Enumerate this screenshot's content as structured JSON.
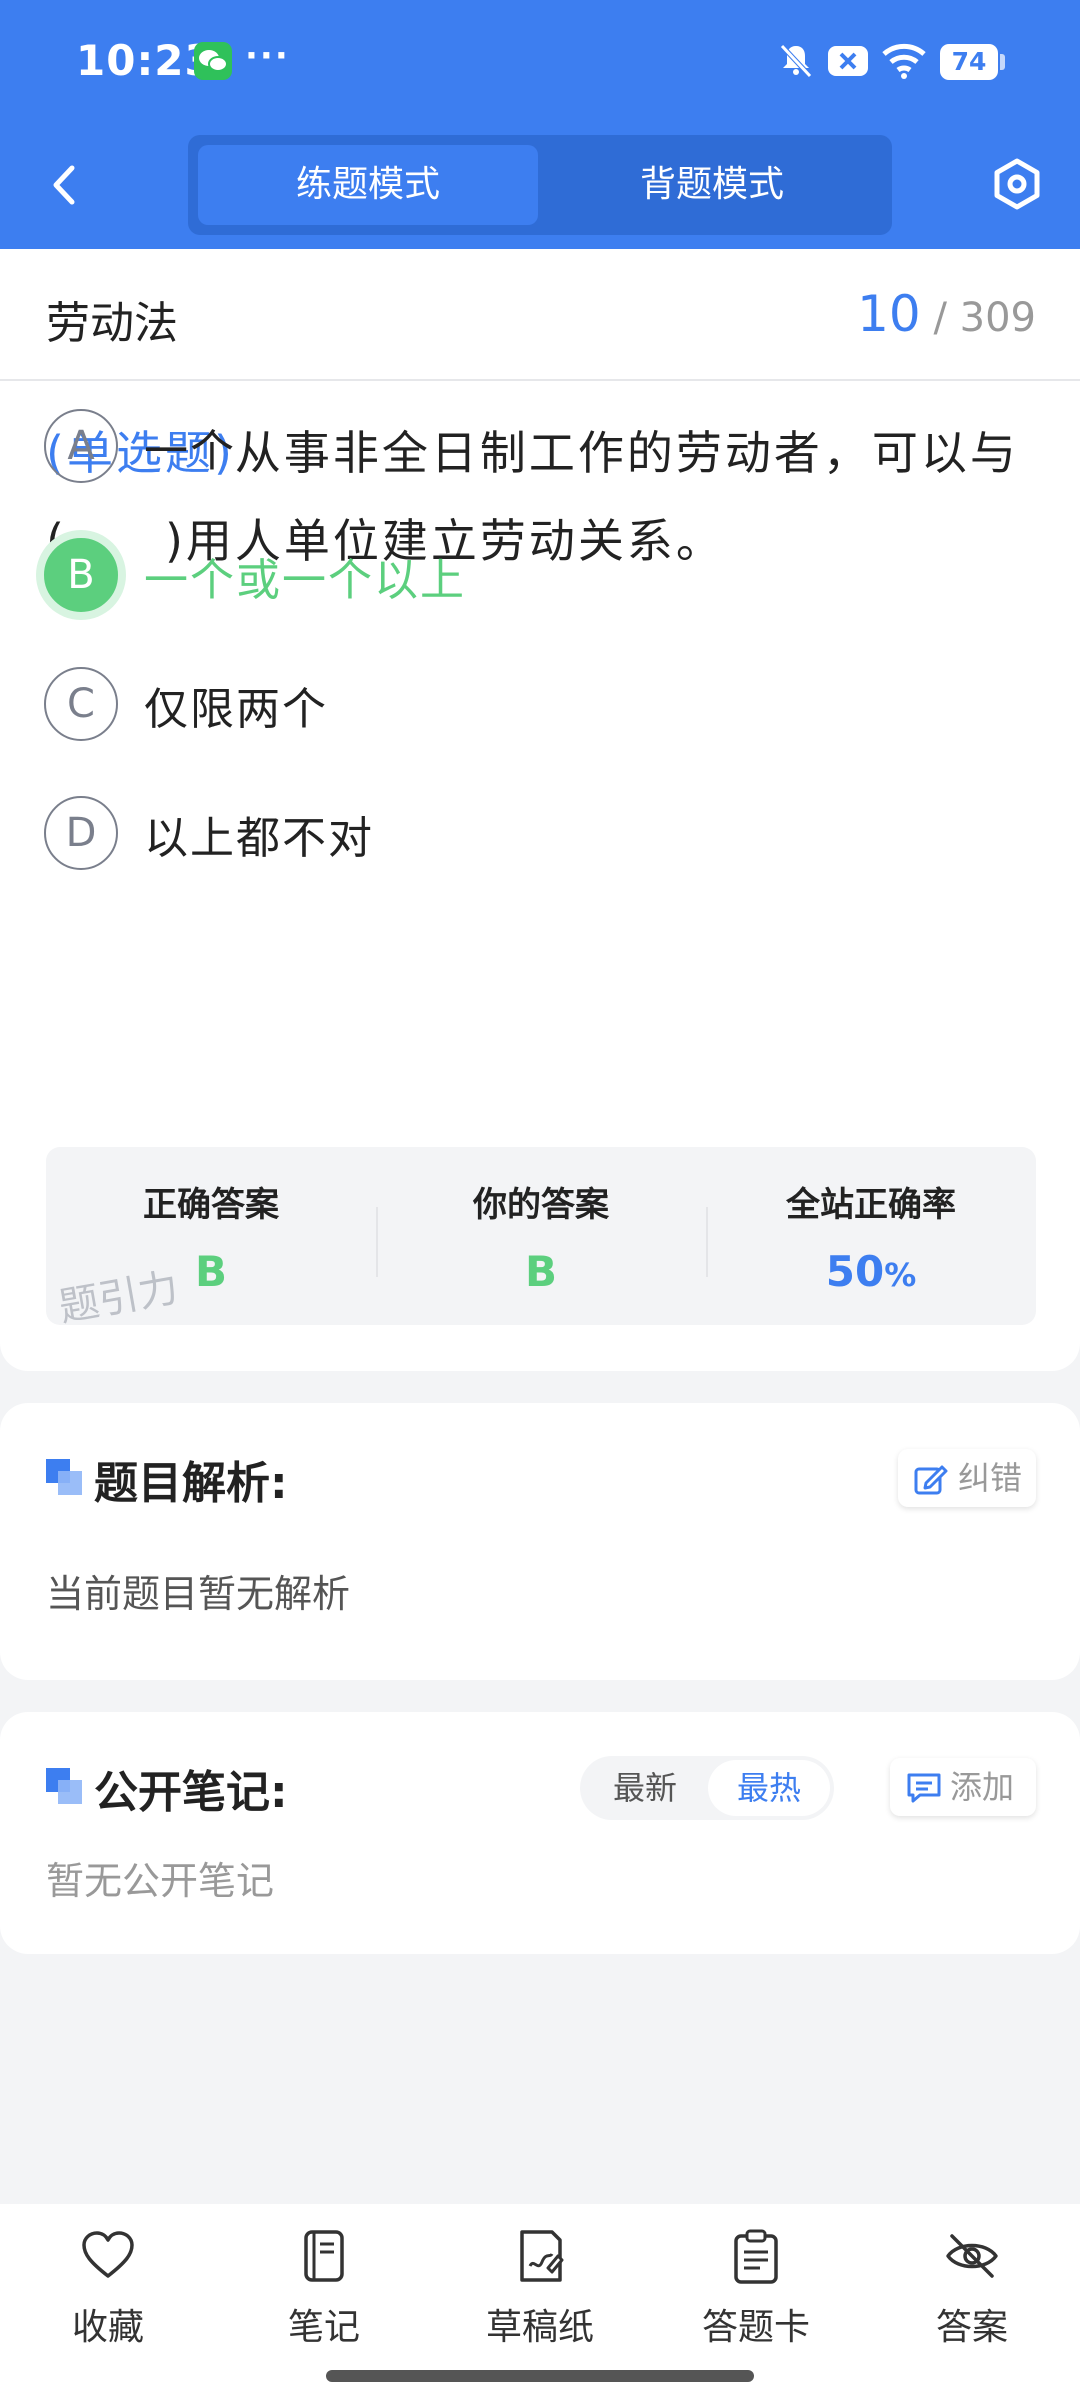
{
  "status_bar": {
    "time": "10:23",
    "dots": "···",
    "battery": "74"
  },
  "header": {
    "tabs": [
      "练题模式",
      "背题模式"
    ],
    "active_tab": "练题模式"
  },
  "question": {
    "subject": "劳动法",
    "current": "10",
    "total": "/ 309",
    "type": "(单选题)",
    "text": "从事非全日制工作的劳动者，可以与(　　)用人单位建立劳动关系。",
    "options": [
      {
        "letter": "A",
        "text": "一个",
        "correct": false
      },
      {
        "letter": "B",
        "text": "一个或一个以上",
        "correct": true
      },
      {
        "letter": "C",
        "text": "仅限两个",
        "correct": false
      },
      {
        "letter": "D",
        "text": "以上都不对",
        "correct": false
      }
    ]
  },
  "stats": {
    "correct_label": "正确答案",
    "correct_value": "B",
    "yours_label": "你的答案",
    "yours_value": "B",
    "rate_label": "全站正确率",
    "rate_value": "50",
    "rate_unit": "%",
    "watermark": "题引力"
  },
  "analysis": {
    "title": "题目解析:",
    "button": "纠错",
    "body": "当前题目暂无解析"
  },
  "notes": {
    "title": "公开笔记:",
    "sort_options": [
      "最新",
      "最热"
    ],
    "active_sort": "最热",
    "button": "添加",
    "body": "暂无公开笔记"
  },
  "bottom_nav": [
    {
      "label": "收藏",
      "icon": "heart-icon"
    },
    {
      "label": "笔记",
      "icon": "notebook-icon"
    },
    {
      "label": "草稿纸",
      "icon": "draft-paper-icon"
    },
    {
      "label": "答题卡",
      "icon": "answer-sheet-icon"
    },
    {
      "label": "答案",
      "icon": "eye-off-icon"
    }
  ],
  "colors": {
    "brand_blue": "#3d7ef0",
    "correct_green": "#5ccf7e"
  }
}
